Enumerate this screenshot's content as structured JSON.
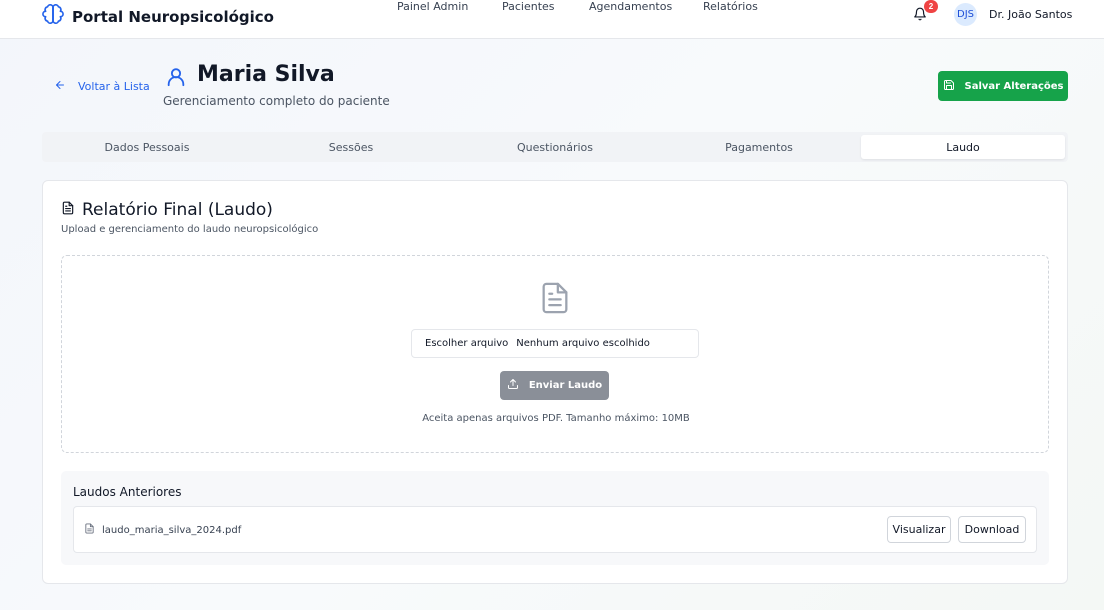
{
  "header": {
    "brand": "Portal Neuropsicológico",
    "nav": [
      "Painel Admin",
      "Pacientes",
      "Agendamentos",
      "Relatórios"
    ],
    "notifications_count": "2",
    "avatar_initials": "DJS",
    "user_name": "Dr. João Santos"
  },
  "page": {
    "back_label": "Voltar à Lista",
    "patient_name": "Maria Silva",
    "subtitle": "Gerenciamento completo do paciente",
    "save_label": "Salvar Alterações"
  },
  "tabs": [
    {
      "label": "Dados Pessoais",
      "active": false
    },
    {
      "label": "Sessões",
      "active": false
    },
    {
      "label": "Questionários",
      "active": false
    },
    {
      "label": "Pagamentos",
      "active": false
    },
    {
      "label": "Laudo",
      "active": true
    }
  ],
  "report": {
    "title": "Relatório Final (Laudo)",
    "subtitle": "Upload e gerenciamento do laudo neuropsicológico",
    "choose_file": "Escolher arquivo",
    "no_file": "Nenhum arquivo escolhido",
    "send_label": "Enviar Laudo",
    "hint": "Aceita apenas arquivos PDF. Tamanho máximo: 10MB"
  },
  "previous": {
    "title": "Laudos Anteriores",
    "files": [
      {
        "name": "laudo_maria_silva_2024.pdf",
        "view_label": "Visualizar",
        "download_label": "Download"
      }
    ]
  },
  "colors": {
    "primary_blue": "#2563eb",
    "save_green": "#16a34a",
    "badge_red": "#ef4444",
    "disabled_gray": "#8a8f98"
  },
  "icons": [
    "brain-icon",
    "arrow-left-icon",
    "user-icon",
    "save-icon",
    "bell-icon",
    "document-icon",
    "upload-icon",
    "file-icon"
  ]
}
